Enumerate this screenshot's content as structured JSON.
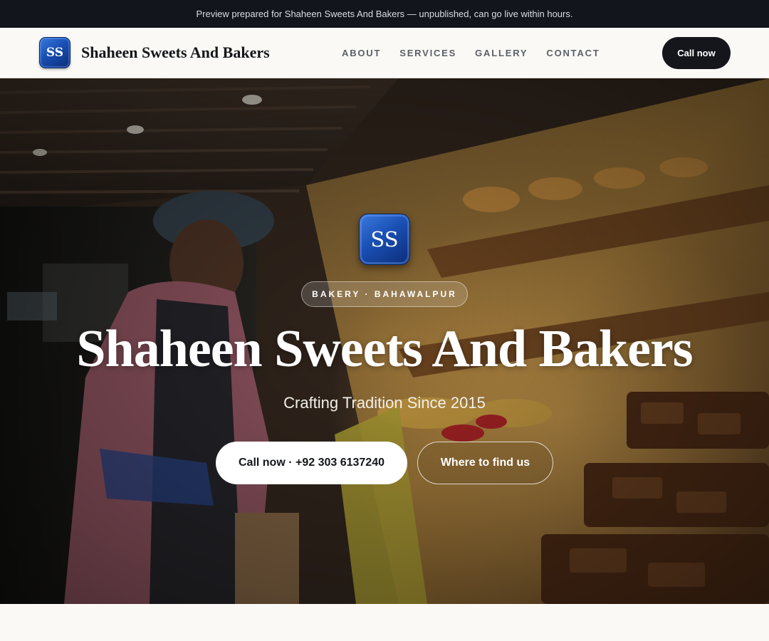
{
  "announcement": "Preview prepared for Shaheen Sweets And Bakers — unpublished, can go live within hours.",
  "header": {
    "logo_initials": "SS",
    "brand_name": "Shaheen Sweets And Bakers",
    "nav": [
      {
        "label": "ABOUT"
      },
      {
        "label": "SERVICES"
      },
      {
        "label": "GALLERY"
      },
      {
        "label": "CONTACT"
      }
    ],
    "cta_label": "Call now"
  },
  "hero": {
    "logo_initials": "SS",
    "tag": "BAKERY · BAHAWALPUR",
    "title": "Shaheen Sweets And Bakers",
    "subtitle": "Crafting Tradition Since 2015",
    "primary_button": "Call now · +92 303 6137240",
    "secondary_button": "Where to find us",
    "background_image": "bakery-display-with-baker-photo"
  },
  "colors": {
    "dark": "#14161b",
    "brand_blue": "#1a4fb3",
    "page_bg": "#faf9f6"
  }
}
